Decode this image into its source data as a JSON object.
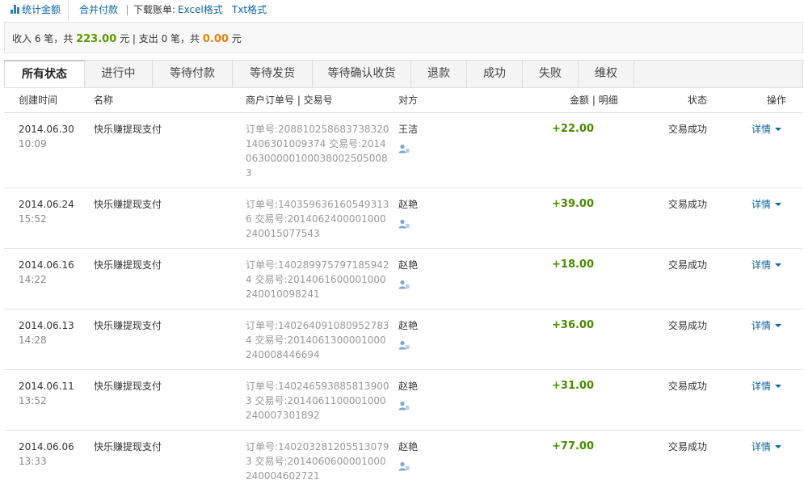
{
  "toolbar": {
    "stat_label": "统计金额",
    "merge_label": "合并付款",
    "download_label": "下载账单:",
    "excel_label": "Excel格式",
    "txt_label": "Txt格式"
  },
  "summary": {
    "income_prefix": "收入 6 笔，共",
    "income_amount": "223.00",
    "income_suffix": "元 | 支出 0 笔，共",
    "expense_amount": "0.00",
    "expense_suffix": "元"
  },
  "tabs": [
    "所有状态",
    "进行中",
    "等待付款",
    "等待发货",
    "等待确认收货",
    "退款",
    "成功",
    "失败",
    "维权"
  ],
  "columns": {
    "created": "创建时间",
    "name": "名称",
    "order": "商户订单号 | 交易号",
    "party": "对方",
    "amount": "金额 | 明细",
    "status": "状态",
    "action": "操作"
  },
  "rows": [
    {
      "date": "2014.06.30",
      "time": "10:09",
      "name": "快乐赚提现支付",
      "trade": "订单号:2088102586837383201406301009374 交易号:2014063000001000380025050083",
      "party": "王洁",
      "amount": "+22.00",
      "status": "交易成功",
      "action": "详情"
    },
    {
      "date": "2014.06.24",
      "time": "15:52",
      "name": "快乐赚提现支付",
      "trade": "订单号:1403596361605493136 交易号:2014062400001000240015077543",
      "party": "赵艳",
      "amount": "+39.00",
      "status": "交易成功",
      "action": "详情"
    },
    {
      "date": "2014.06.16",
      "time": "14:22",
      "name": "快乐赚提现支付",
      "trade": "订单号:1402899757971859424 交易号:2014061600001000240010098241",
      "party": "赵艳",
      "amount": "+18.00",
      "status": "交易成功",
      "action": "详情"
    },
    {
      "date": "2014.06.13",
      "time": "14:28",
      "name": "快乐赚提现支付",
      "trade": "订单号:1402640910809527834 交易号:2014061300001000240008446694",
      "party": "赵艳",
      "amount": "+36.00",
      "status": "交易成功",
      "action": "详情"
    },
    {
      "date": "2014.06.11",
      "time": "13:52",
      "name": "快乐赚提现支付",
      "trade": "订单号:1402465938858139003 交易号:2014061100001000240007301892",
      "party": "赵艳",
      "amount": "+31.00",
      "status": "交易成功",
      "action": "详情"
    },
    {
      "date": "2014.06.06",
      "time": "13:33",
      "name": "快乐赚提现支付",
      "trade": "订单号:1402032812055130793 交易号:2014060600001000240004602721",
      "party": "赵艳",
      "amount": "+77.00",
      "status": "交易成功",
      "action": "详情"
    }
  ],
  "colors": {
    "link": "#0b66a6",
    "income": "#5b9a00",
    "expense": "#e8800a"
  }
}
